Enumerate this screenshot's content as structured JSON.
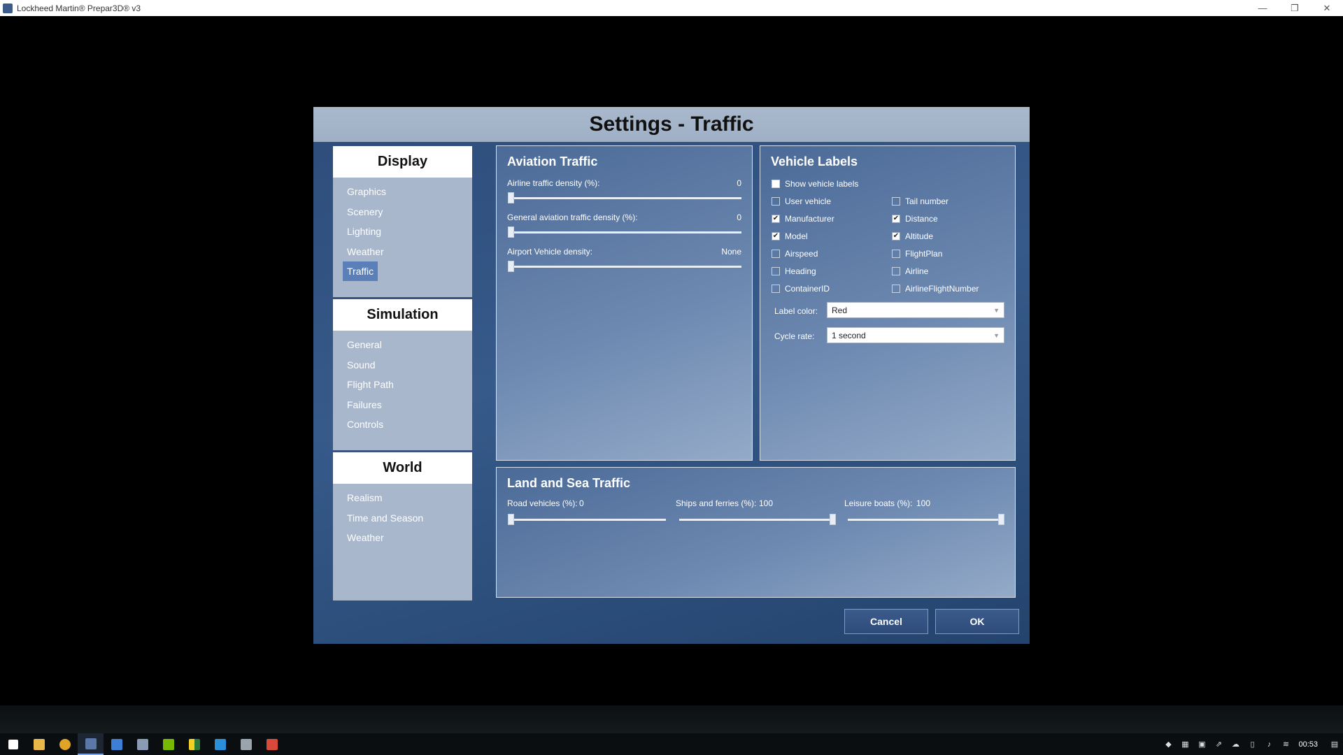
{
  "window": {
    "title": "Lockheed Martin® Prepar3D® v3",
    "minimize": "—",
    "restore": "❐",
    "close": "✕"
  },
  "dialog": {
    "title": "Settings - Traffic"
  },
  "nav": {
    "groups": [
      {
        "heading": "Display",
        "items": [
          "Graphics",
          "Scenery",
          "Lighting",
          "Weather",
          "Traffic"
        ]
      },
      {
        "heading": "Simulation",
        "items": [
          "General",
          "Sound",
          "Flight Path",
          "Failures",
          "Controls"
        ]
      },
      {
        "heading": "World",
        "items": [
          "Realism",
          "Time and Season",
          "Weather"
        ]
      }
    ],
    "active": "Traffic"
  },
  "aviation": {
    "heading": "Aviation Traffic",
    "sliders": [
      {
        "label": "Airline traffic density (%):",
        "value": "0",
        "level": 0
      },
      {
        "label": "General aviation traffic density (%):",
        "value": "0",
        "level": 0
      },
      {
        "label": "Airport Vehicle density:",
        "value": "None",
        "level": 0
      }
    ]
  },
  "vehicle_labels": {
    "heading": "Vehicle Labels",
    "show_label": "Show vehicle labels",
    "show_checked": false,
    "left": [
      {
        "label": "User vehicle",
        "checked": false
      },
      {
        "label": "Manufacturer",
        "checked": true
      },
      {
        "label": "Model",
        "checked": true
      },
      {
        "label": "Airspeed",
        "checked": false
      },
      {
        "label": "Heading",
        "checked": false
      },
      {
        "label": "ContainerID",
        "checked": false
      }
    ],
    "right": [
      {
        "label": "Tail number",
        "checked": false
      },
      {
        "label": "Distance",
        "checked": true
      },
      {
        "label": "Altitude",
        "checked": true
      },
      {
        "label": "FlightPlan",
        "checked": false
      },
      {
        "label": "Airline",
        "checked": false
      },
      {
        "label": "AirlineFlightNumber",
        "checked": false
      }
    ],
    "label_color_label": "Label color:",
    "label_color_value": "Red",
    "cycle_rate_label": "Cycle rate:",
    "cycle_rate_value": "1 second"
  },
  "land_sea": {
    "heading": "Land and Sea Traffic",
    "sliders": [
      {
        "label": "Road vehicles (%):",
        "value": "0",
        "level": 0
      },
      {
        "label": "Ships and ferries (%):",
        "value": "100",
        "level": 100
      },
      {
        "label": "Leisure boats (%):",
        "value": "100",
        "level": 100
      }
    ]
  },
  "buttons": {
    "cancel": "Cancel",
    "ok": "OK"
  },
  "taskbar": {
    "clock": "00:53",
    "icons": [
      "windows-start-icon",
      "file-explorer-icon",
      "chrome-icon",
      "prepar3d-icon",
      "flight-app-icon",
      "monitor-app-icon",
      "nvidia-icon",
      "stripes-app-icon",
      "app-blue-icon",
      "app-chart-icon",
      "app-red-icon"
    ]
  }
}
